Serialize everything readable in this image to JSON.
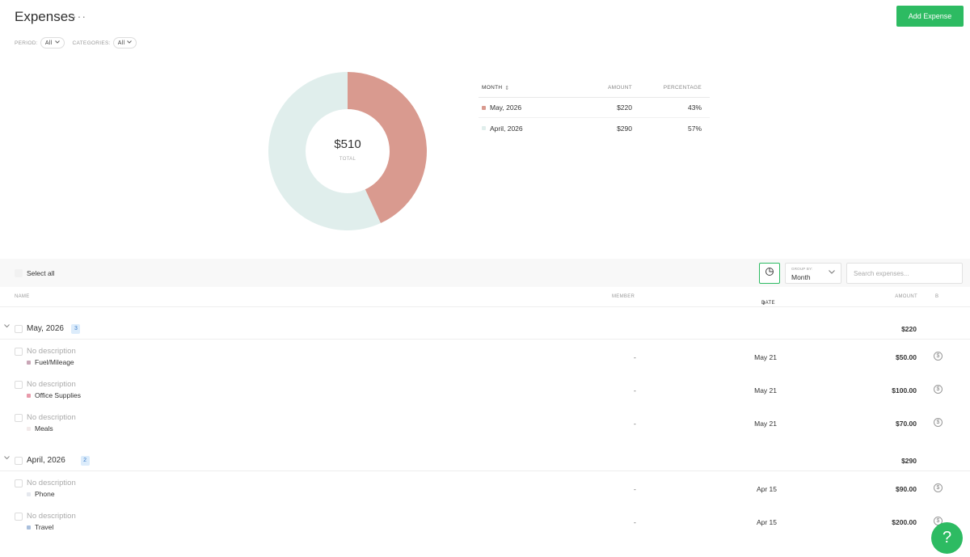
{
  "header": {
    "title": "Expenses",
    "more_icon": "more-horizontal-icon",
    "add_button": "Add Expense"
  },
  "filters": {
    "period_label": "PERIOD:",
    "period_value": "All",
    "categories_label": "CATEGORIES:",
    "categories_value": "All"
  },
  "summary": {
    "total": "$510",
    "total_label": "TOTAL",
    "columns": {
      "month": "MONTH",
      "amount": "AMOUNT",
      "percentage": "PERCENTAGE"
    },
    "rows": [
      {
        "month": "May, 2026",
        "amount": "$220",
        "percentage": "43%",
        "color": "#d99a8f"
      },
      {
        "month": "April, 2026",
        "amount": "$290",
        "percentage": "57%",
        "color": "#e0eeec"
      }
    ]
  },
  "chart_data": {
    "type": "pie",
    "categories": [
      "May, 2026",
      "April, 2026"
    ],
    "values": [
      220,
      290
    ],
    "colors": [
      "#d99a8f",
      "#e0eeec"
    ]
  },
  "toolbar": {
    "select_all": "Select all",
    "chart_icon": "pie-chart-icon",
    "group_by_label": "GROUP BY:",
    "group_by_value": "Month",
    "search_placeholder": "Search expenses..."
  },
  "list": {
    "columns": {
      "name": "NAME",
      "member": "MEMBER",
      "date": "DATE",
      "amount": "AMOUNT",
      "icon": "B"
    },
    "groups": [
      {
        "name": "May, 2026",
        "count": "3",
        "total": "$220",
        "items": [
          {
            "description": "No description",
            "category": "Fuel/Mileage",
            "color": "#c9a6b6",
            "member": "-",
            "date": "May 21",
            "amount": "$50.00"
          },
          {
            "description": "No description",
            "category": "Office Supplies",
            "color": "#e89aaa",
            "member": "-",
            "date": "May 21",
            "amount": "$100.00"
          },
          {
            "description": "No description",
            "category": "Meals",
            "color": "#f2eaea",
            "member": "-",
            "date": "May 21",
            "amount": "$70.00"
          }
        ]
      },
      {
        "name": "April, 2026",
        "count": "2",
        "total": "$290",
        "items": [
          {
            "description": "No description",
            "category": "Phone",
            "color": "#e5e8ee",
            "member": "-",
            "date": "Apr 15",
            "amount": "$90.00"
          },
          {
            "description": "No description",
            "category": "Travel",
            "color": "#a9bfdc",
            "member": "-",
            "date": "Apr 15",
            "amount": "$200.00"
          }
        ]
      }
    ]
  },
  "help": {
    "label": "?"
  }
}
